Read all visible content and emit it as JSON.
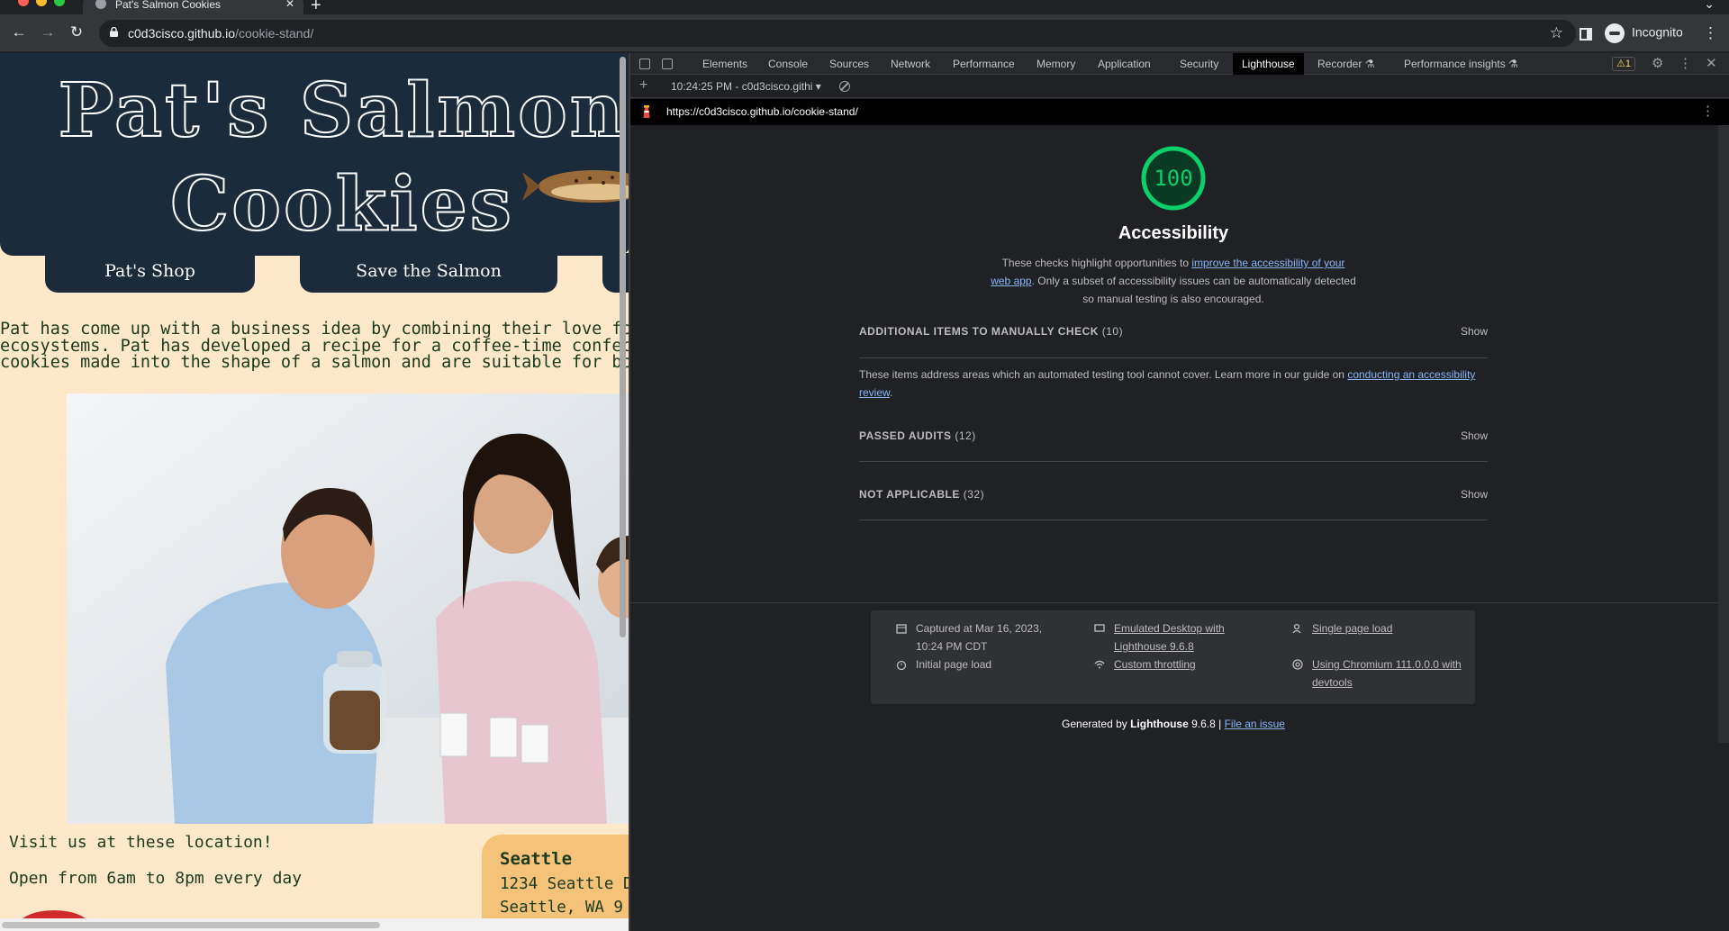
{
  "browser": {
    "tab_title": "Pat's Salmon Cookies",
    "url_host": "c0d3cisco.github.io",
    "url_path": "/cookie-stand/",
    "profile_label": "Incognito"
  },
  "site": {
    "title_line1": "Pat's Salmon",
    "title_line2": "Cookies",
    "nav": [
      "Pat's Shop",
      "Save the Salmon"
    ],
    "intro_lines": [
      "Pat has come up with a business idea by combining their love for sweet",
      "ecosystems. Pat has developed a recipe for a coffee-time confection ca",
      "cookies made into the shape of a salmon and are suitable for both hu"
    ],
    "visit_text": "Visit us at these location!",
    "hours_text": "Open from 6am to 8pm every day",
    "store": {
      "name": "Seattle",
      "street": "1234 Seattle D",
      "city": "Seattle, WA 9"
    }
  },
  "devtools": {
    "tabs": [
      "Elements",
      "Console",
      "Sources",
      "Network",
      "Performance",
      "Memory",
      "Application",
      "Security",
      "Lighthouse",
      "Recorder ⚗",
      "Performance insights ⚗"
    ],
    "active_tab": "Lighthouse",
    "warning_count": "⚠1",
    "report_select": "10:24:25 PM - c0d3cisco.githi ▾",
    "report_url": "https://c0d3cisco.github.io/cookie-stand/"
  },
  "lighthouse": {
    "score": "100",
    "score_color": "#0cce6b",
    "category": "Accessibility",
    "desc_before": "These checks highlight opportunities to ",
    "desc_link": "improve the accessibility of your web app",
    "desc_after": ". Only a subset of accessibility issues can be automatically detected so manual testing is also encouraged.",
    "groups": {
      "manual": {
        "title": "ADDITIONAL ITEMS TO MANUALLY CHECK",
        "count": "(10)",
        "show": "Show"
      },
      "passed": {
        "title": "PASSED AUDITS",
        "count": "(12)",
        "show": "Show"
      },
      "na": {
        "title": "NOT APPLICABLE",
        "count": "(32)",
        "show": "Show"
      }
    },
    "manual_desc_before": "These items address areas which an automated testing tool cannot cover. Learn more in our guide on ",
    "manual_desc_link": "conducting an accessibility review",
    "manual_desc_after": ".",
    "meta": {
      "captured": "Captured at Mar 16, 2023, 10:24 PM CDT",
      "initial": "Initial page load",
      "emulated": "Emulated Desktop with Lighthouse 9.6.8",
      "throttling": "Custom throttling",
      "single": "Single page load",
      "chromium": "Using Chromium 111.0.0.0 with devtools"
    },
    "generated_prefix": "Generated by ",
    "generated_tool": "Lighthouse",
    "generated_version": " 9.6.8 | ",
    "file_issue": "File an issue"
  }
}
